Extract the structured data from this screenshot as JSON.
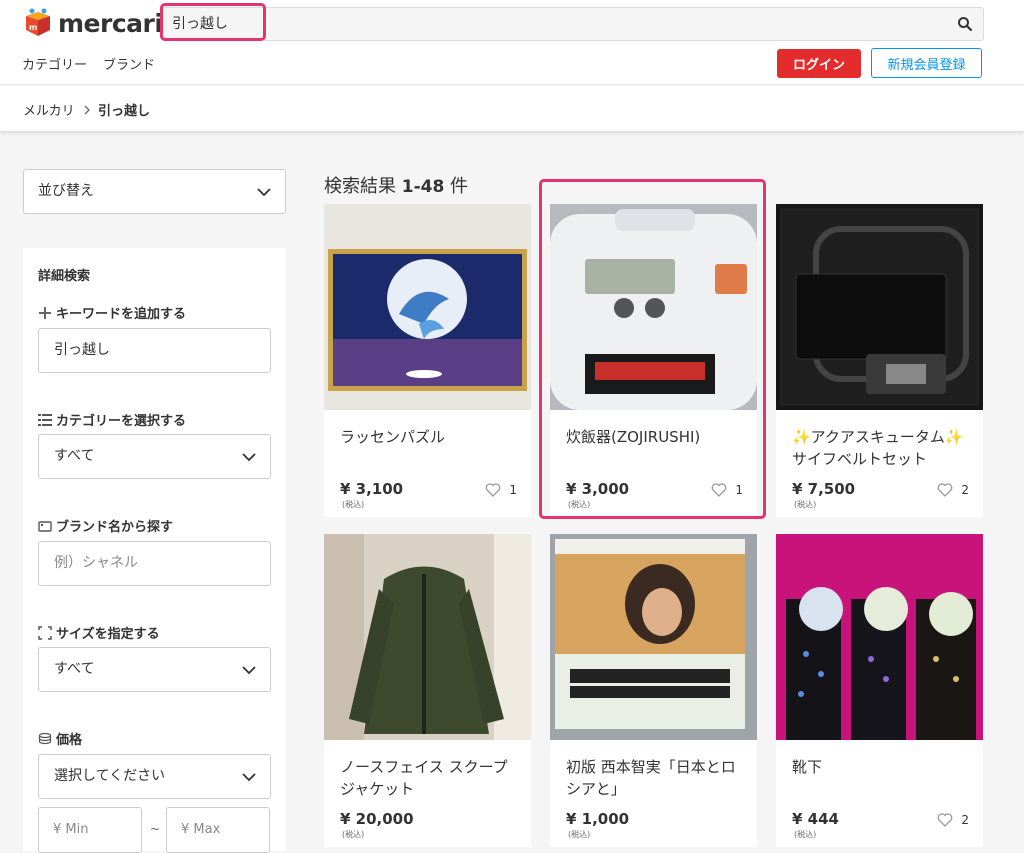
{
  "header": {
    "logo_text": "mercari",
    "search_value": "引っ越し",
    "nav": [
      "カテゴリー",
      "ブランド"
    ],
    "login_label": "ログイン",
    "signup_label": "新規会員登録"
  },
  "breadcrumb": {
    "root": "メルカリ",
    "current": "引っ越し"
  },
  "sidebar": {
    "sort_label": "並び替え",
    "panel_title": "詳細検索",
    "keyword_label": "キーワードを追加する",
    "keyword_value": "引っ越し",
    "category_label": "カテゴリーを選択する",
    "category_value": "すべて",
    "brand_label": "ブランド名から探す",
    "brand_placeholder": "例）シャネル",
    "size_label": "サイズを指定する",
    "size_value": "すべて",
    "price_label": "価格",
    "price_select": "選択してください",
    "min_placeholder": "¥ Min",
    "max_placeholder": "¥ Max",
    "range_sep": "~"
  },
  "results": {
    "title": "検索結果",
    "range": "1-48",
    "unit": "件"
  },
  "items": [
    {
      "name": "ラッセンパズル",
      "price": "¥ 3,100",
      "tax": "(税込)",
      "likes": "1"
    },
    {
      "name": "炊飯器(ZOJIRUSHI)",
      "price": "¥ 3,000",
      "tax": "(税込)",
      "likes": "1"
    },
    {
      "name": "✨アクアスキュータム✨サイフベルトセット",
      "price": "¥ 7,500",
      "tax": "(税込)",
      "likes": "2"
    },
    {
      "name": "ノースフェイス スクープジャケット",
      "price": "¥ 20,000",
      "tax": "(税込)",
      "likes": ""
    },
    {
      "name": "初版 西本智実「日本とロシアと」",
      "price": "¥ 1,000",
      "tax": "(税込)",
      "likes": ""
    },
    {
      "name": "靴下",
      "price": "¥ 444",
      "tax": "(税込)",
      "likes": "2"
    }
  ],
  "colors": {
    "accent_red": "#e52c2c",
    "link_blue": "#0095ee",
    "highlight_pink": "#e5336b"
  }
}
